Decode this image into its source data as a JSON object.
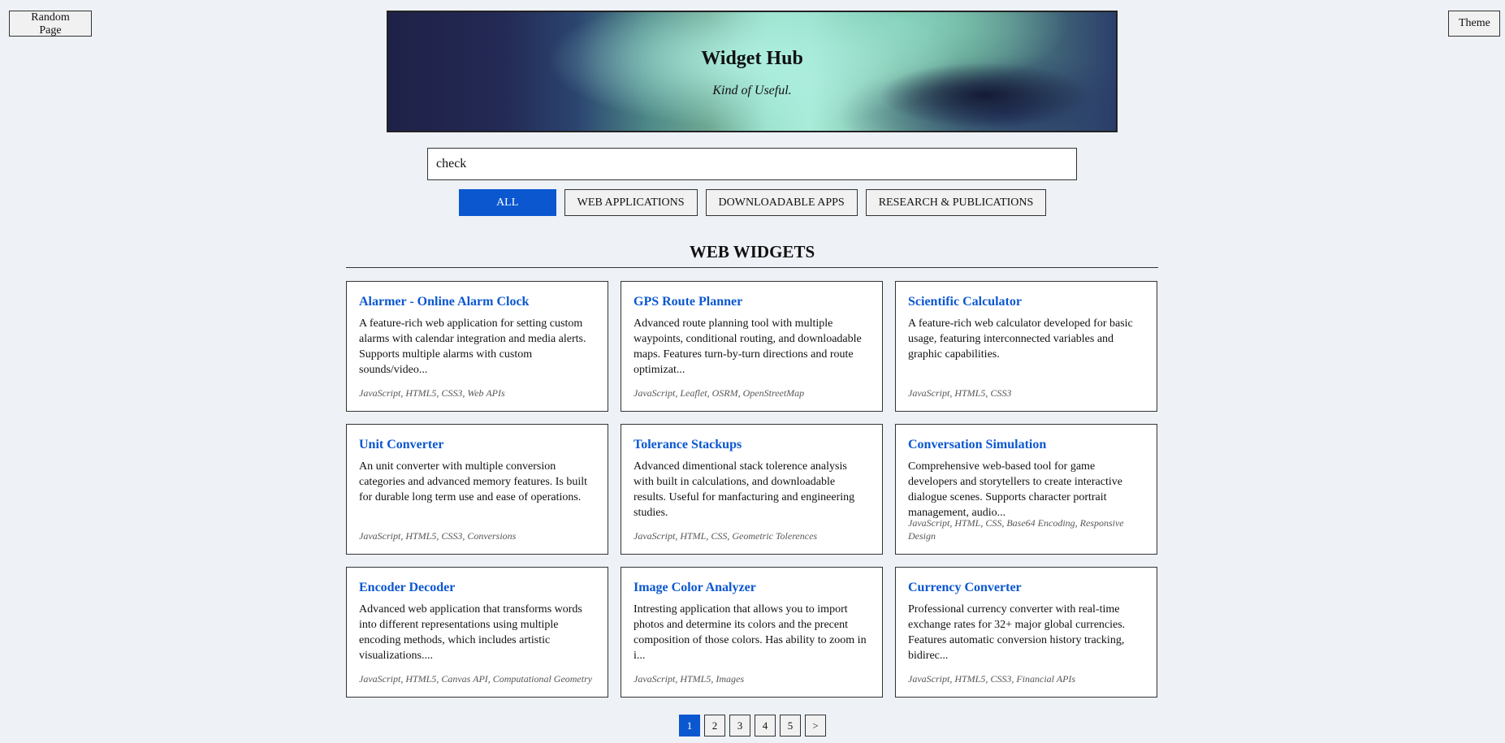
{
  "header": {
    "random_label": "Random Page",
    "theme_label": "Theme",
    "title": "Widget Hub",
    "tagline": "Kind of Useful."
  },
  "search": {
    "value": "check"
  },
  "filters": [
    {
      "label": "ALL",
      "active": true
    },
    {
      "label": "WEB APPLICATIONS",
      "active": false
    },
    {
      "label": "DOWNLOADABLE APPS",
      "active": false
    },
    {
      "label": "RESEARCH & PUBLICATIONS",
      "active": false
    }
  ],
  "section": {
    "title": "WEB WIDGETS"
  },
  "cards": [
    {
      "title": "Alarmer - Online Alarm Clock",
      "desc": "A feature-rich web application for setting custom alarms with calendar integration and media alerts. Supports multiple alarms with custom sounds/video...",
      "tags": "JavaScript, HTML5, CSS3, Web APIs"
    },
    {
      "title": "GPS Route Planner",
      "desc": "Advanced route planning tool with multiple waypoints, conditional routing, and downloadable maps. Features turn-by-turn directions and route optimizat...",
      "tags": "JavaScript, Leaflet, OSRM, OpenStreetMap"
    },
    {
      "title": "Scientific Calculator",
      "desc": "A feature-rich web calculator developed for basic usage, featuring interconnected variables and graphic capabilities.",
      "tags": "JavaScript, HTML5, CSS3"
    },
    {
      "title": "Unit Converter",
      "desc": "An unit converter with multiple conversion categories and advanced memory features. Is built for durable long term use and ease of operations.",
      "tags": "JavaScript, HTML5, CSS3, Conversions"
    },
    {
      "title": "Tolerance Stackups",
      "desc": "Advanced dimentional stack tolerence analysis with built in calculations, and downloadable results. Useful for manfacturing and engineering studies.",
      "tags": "JavaScript, HTML, CSS, Geometric Tolerences"
    },
    {
      "title": "Conversation Simulation",
      "desc": "Comprehensive web-based tool for game developers and storytellers to create interactive dialogue scenes. Supports character portrait management, audio...",
      "tags": "JavaScript, HTML, CSS, Base64 Encoding, Responsive Design"
    },
    {
      "title": "Encoder Decoder",
      "desc": "Advanced web application that transforms words into different representations using multiple encoding methods, which includes artistic visualizations....",
      "tags": "JavaScript, HTML5, Canvas API, Computational Geometry"
    },
    {
      "title": "Image Color Analyzer",
      "desc": "Intresting application that allows you to import photos and determine its colors and the precent composition of those colors. Has ability to zoom in i...",
      "tags": "JavaScript, HTML5, Images"
    },
    {
      "title": "Currency Converter",
      "desc": "Professional currency converter with real-time exchange rates for 32+ major global currencies. Features automatic conversion history tracking, bidirec...",
      "tags": "JavaScript, HTML5, CSS3, Financial APIs"
    }
  ],
  "pagination": {
    "pages": [
      "1",
      "2",
      "3",
      "4",
      "5"
    ],
    "current": "1",
    "next_label": ">"
  },
  "colors": {
    "accent": "#0b57d0",
    "background": "#eef1f6"
  }
}
